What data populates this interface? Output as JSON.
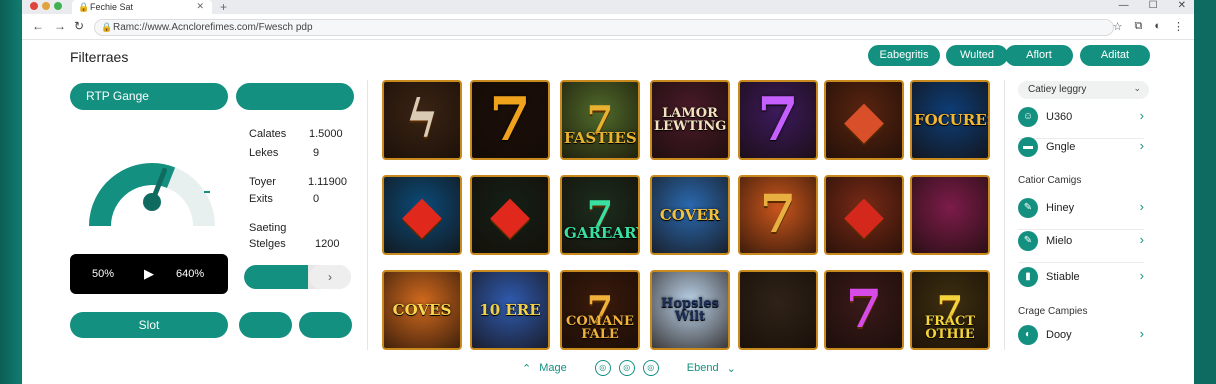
{
  "browser": {
    "tab_title": "Fechie Sat",
    "url": "Ramc://www.Acnclorefimes.com/Fwesch pdp",
    "controls": [
      "—",
      "☐",
      "✕"
    ]
  },
  "page": {
    "title": "Filterraes",
    "top_buttons": [
      "Eabegritis",
      "Wulted",
      "Aflort",
      "Aditat"
    ]
  },
  "filters": {
    "rtp_button": "RTP Gange",
    "rtp_level": 0.62,
    "stats": [
      {
        "label": "Calates",
        "value": "1.5000"
      },
      {
        "label": "Lekes",
        "value": "9"
      },
      {
        "label": "Toyer",
        "value": "1.11900"
      },
      {
        "label": "Exits",
        "value": "0"
      },
      {
        "label": "Saeting",
        "value": ""
      },
      {
        "label": "Stelges",
        "value": "1200"
      }
    ],
    "range_min": "50%",
    "range_max": "640%",
    "slider_level": 0.6,
    "slot_button": "Slot"
  },
  "games": [
    {
      "text": "",
      "bg": "#3b2414",
      "fg": "#d9cbb4",
      "glyph": "ϟ"
    },
    {
      "text": "7",
      "bg": "#1a0e08",
      "fg": "#f0a21c",
      "glyph": ""
    },
    {
      "text": "FASTIES",
      "bg": "#4f6a2a",
      "fg": "#e8b230",
      "glyph": "7"
    },
    {
      "text": "LAMOR LEWTING",
      "bg": "#4a1b2a",
      "fg": "#f3e4c0",
      "glyph": ""
    },
    {
      "text": "7",
      "bg": "#3c1a5c",
      "fg": "#c560ff",
      "glyph": ""
    },
    {
      "text": "",
      "bg": "#5a2410",
      "fg": "#d84f2a",
      "glyph": "◆"
    },
    {
      "text": "FOCURES",
      "bg": "#0d3e78",
      "fg": "#f2b632",
      "glyph": ""
    },
    {
      "text": "",
      "bg": "#0b4b7a",
      "fg": "#e0281d",
      "glyph": "◆"
    },
    {
      "text": "",
      "bg": "#142017",
      "fg": "#e0281d",
      "glyph": "◆"
    },
    {
      "text": "GAREARY",
      "bg": "#1b2d1d",
      "fg": "#39e0a2",
      "glyph": "7"
    },
    {
      "text": "COVER",
      "bg": "#2a6ab1",
      "fg": "#f2c13e",
      "glyph": ""
    },
    {
      "text": "",
      "bg": "#c9561c",
      "fg": "#e8b040",
      "glyph": "7"
    },
    {
      "text": "",
      "bg": "#7a2a16",
      "fg": "#d4281d",
      "glyph": "◆"
    },
    {
      "text": "",
      "bg": "#7c1c4a",
      "fg": "#d042ff",
      "glyph": ""
    },
    {
      "text": "COVES",
      "bg": "#d26a1e",
      "fg": "#f7d64b",
      "glyph": ""
    },
    {
      "text": "10 ERE",
      "bg": "#2f5bb0",
      "fg": "#f2d14a",
      "glyph": ""
    },
    {
      "text": "COMANE FALE",
      "bg": "#3a1a0b",
      "fg": "#f0b23a",
      "glyph": "7"
    },
    {
      "text": "Hopsles Wilt",
      "bg": "#bcd3ea",
      "fg": "#1c2d58",
      "glyph": ""
    },
    {
      "text": "",
      "bg": "#2f2318",
      "fg": "#e8a23a",
      "glyph": ""
    },
    {
      "text": "",
      "bg": "#3a1a1a",
      "fg": "#d74be6",
      "glyph": "7"
    },
    {
      "text": "FRACT OTHIE",
      "bg": "#3d2f10",
      "fg": "#f5d33a",
      "glyph": "7"
    }
  ],
  "sidebar": {
    "dropdown": "Catiey leggry",
    "sections": [
      "Catior Camigs",
      "Crage Campies"
    ],
    "items": [
      {
        "label": "U360",
        "icon": "☺"
      },
      {
        "label": "Gngle",
        "icon": "▬"
      },
      {
        "label": "Hiney",
        "icon": "✎"
      },
      {
        "label": "Mielo",
        "icon": "✎"
      },
      {
        "label": "Stiable",
        "icon": "▮"
      },
      {
        "label": "Dooy",
        "icon": "◐"
      }
    ]
  },
  "footer": {
    "left_label": "Mage",
    "right_label": "Ebend"
  }
}
